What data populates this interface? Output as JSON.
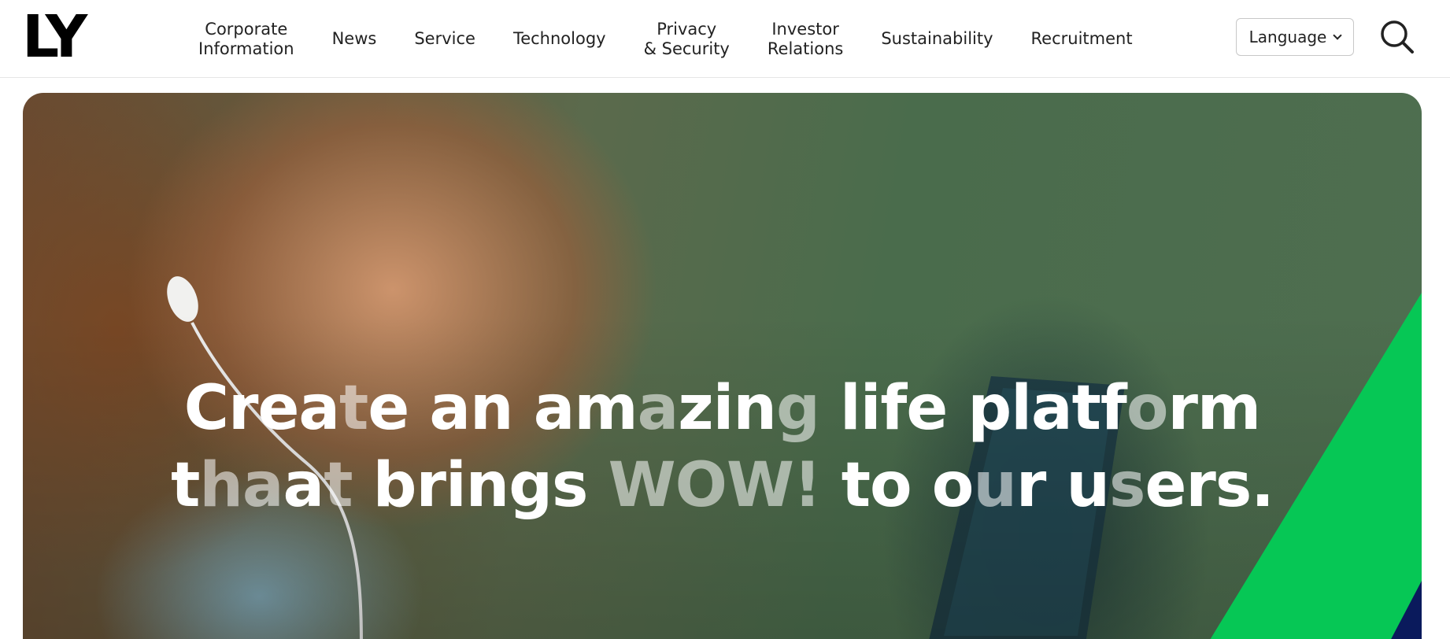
{
  "header": {
    "logo_text": "LY",
    "nav": [
      {
        "line1": "Corporate",
        "line2": "Information"
      },
      {
        "line1": "News",
        "line2": ""
      },
      {
        "line1": "Service",
        "line2": ""
      },
      {
        "line1": "Technology",
        "line2": ""
      },
      {
        "line1": "Privacy",
        "line2": "& Security"
      },
      {
        "line1": "Investor",
        "line2": "Relations"
      },
      {
        "line1": "Sustainability",
        "line2": ""
      },
      {
        "line1": "Recruitment",
        "line2": ""
      }
    ],
    "language_label": "Language",
    "search_icon": "search-icon"
  },
  "hero": {
    "line1": {
      "parts": [
        {
          "text": "Crea",
          "dim": false
        },
        {
          "text": "t",
          "dim": true
        },
        {
          "text": "e an am",
          "dim": false
        },
        {
          "text": "a",
          "dim": true
        },
        {
          "text": "zin",
          "dim": false
        },
        {
          "text": "g",
          "dim": true
        },
        {
          "text": " life platf",
          "dim": false
        },
        {
          "text": "o",
          "dim": true
        },
        {
          "text": "rm",
          "dim": false
        }
      ]
    },
    "line2": {
      "parts": [
        {
          "text": "t",
          "dim": false
        },
        {
          "text": "ha",
          "dim": true
        },
        {
          "text": "a",
          "dim": false
        },
        {
          "text": "t",
          "dim": true
        },
        {
          "text": " brings ",
          "dim": false
        },
        {
          "text": "WOW!",
          "dim": true
        },
        {
          "text": " to o",
          "dim": false
        },
        {
          "text": "u",
          "dim": true
        },
        {
          "text": "r u",
          "dim": false
        },
        {
          "text": "s",
          "dim": true
        },
        {
          "text": "ers.",
          "dim": false
        }
      ]
    },
    "accent_color": "#06c755",
    "corner_color": "#0a1a5c"
  }
}
